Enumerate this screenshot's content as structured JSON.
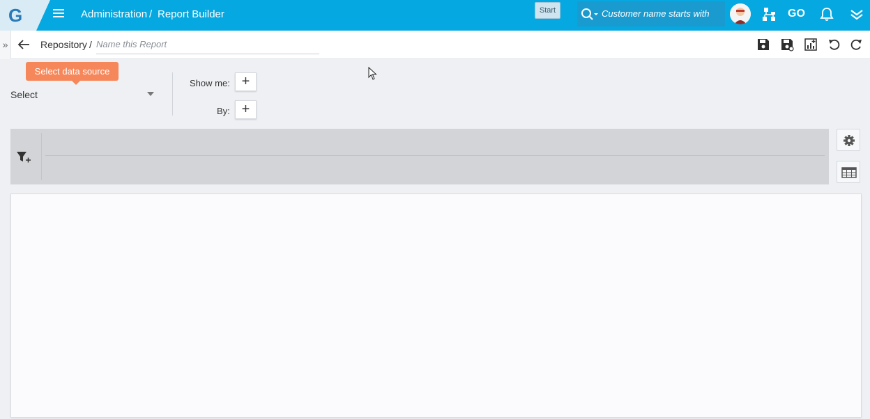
{
  "header": {
    "logo_letter": "G",
    "breadcrumb_section": "Administration",
    "breadcrumb_separator": "/",
    "breadcrumb_page": "Report Builder",
    "start_label": "Start",
    "search_placeholder": "Customer name starts with",
    "go_label": "GO",
    "accent_color": "#05a8e0",
    "icons": [
      "menu-icon",
      "search-icon",
      "avatar",
      "hierarchy-icon",
      "bell-icon",
      "chevron-double-down-icon"
    ]
  },
  "toolbar": {
    "expand_glyph": "»",
    "repository_label": "Repository",
    "separator": "/",
    "report_name_placeholder": "Name this Report",
    "report_name_value": "",
    "icons": [
      "save-icon",
      "save-as-icon",
      "chart-icon",
      "undo-icon",
      "refresh-icon"
    ]
  },
  "datasource": {
    "tooltip": "Select data source",
    "select_value": "Select",
    "tooltip_color": "#f6875a"
  },
  "fields": {
    "show_me_label": "Show me:",
    "by_label": "By:",
    "add_glyph": "+"
  },
  "filter_bar": {
    "icon": "filter-add-icon"
  },
  "side_actions": {
    "icons": [
      "settings-icon",
      "table-icon"
    ]
  }
}
